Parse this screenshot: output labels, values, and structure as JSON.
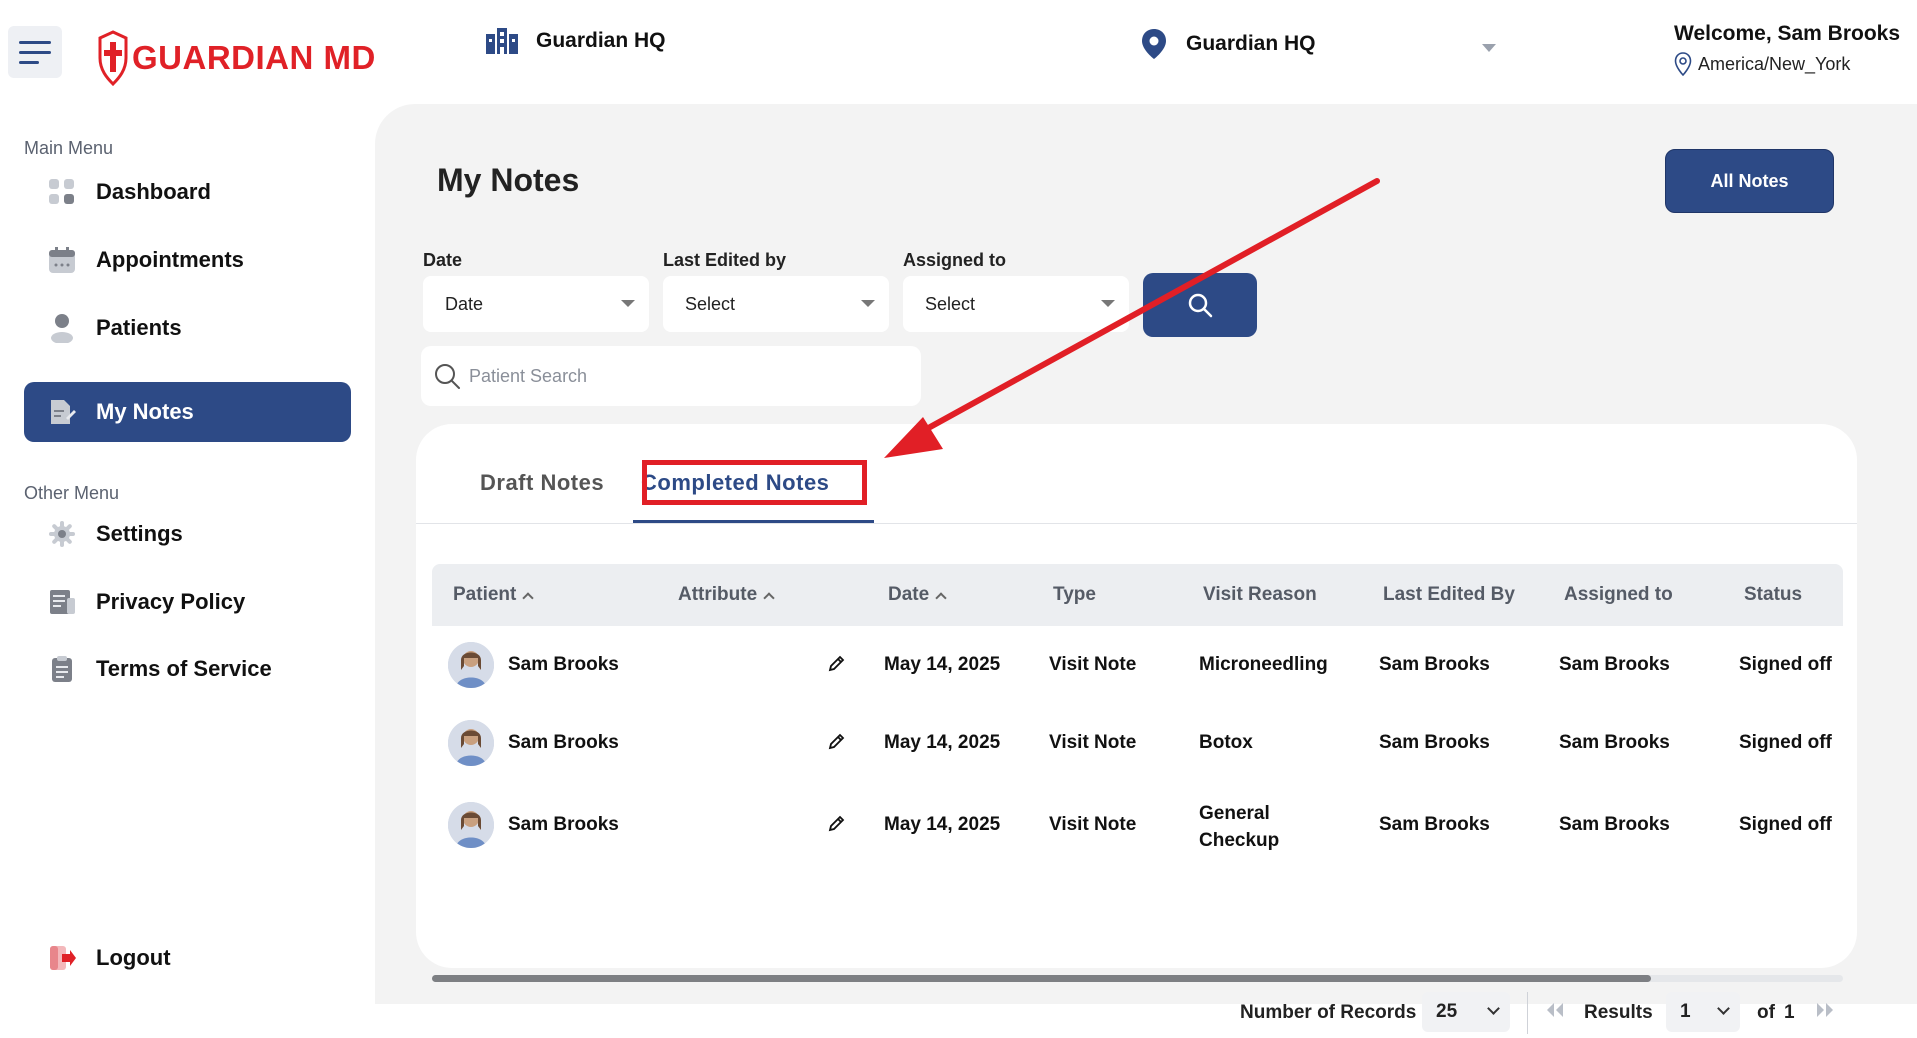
{
  "header": {
    "logo_text": "GUARDIAN MD",
    "org_name": "Guardian HQ",
    "location_name": "Guardian HQ",
    "welcome": "Welcome, Sam Brooks",
    "timezone": "America/New_York"
  },
  "sidebar": {
    "main_heading": "Main Menu",
    "other_heading": "Other Menu",
    "main_items": [
      {
        "label": "Dashboard",
        "icon": "dashboard-icon"
      },
      {
        "label": "Appointments",
        "icon": "calendar-icon"
      },
      {
        "label": "Patients",
        "icon": "user-icon"
      },
      {
        "label": "My Notes",
        "icon": "notes-icon",
        "active": true
      }
    ],
    "other_items": [
      {
        "label": "Settings",
        "icon": "gear-icon"
      },
      {
        "label": "Privacy Policy",
        "icon": "document-icon"
      },
      {
        "label": "Terms of Service",
        "icon": "clipboard-icon"
      }
    ],
    "logout": "Logout"
  },
  "main": {
    "title": "My Notes",
    "all_notes_label": "All Notes",
    "filters": {
      "date_label": "Date",
      "date_value": "Date",
      "edited_label": "Last Edited by",
      "edited_value": "Select",
      "assigned_label": "Assigned to",
      "assigned_value": "Select"
    },
    "search_placeholder": "Patient Search",
    "tabs": {
      "draft": "Draft Notes",
      "completed": "Completed Notes",
      "active": "completed"
    },
    "table": {
      "headers": [
        "Patient",
        "Attribute",
        "Date",
        "Type",
        "Visit Reason",
        "Last Edited By",
        "Assigned to",
        "Status"
      ],
      "rows": [
        [
          "Sam Brooks",
          "",
          "May 14, 2025",
          "Visit Note",
          "Microneedling",
          "Sam Brooks",
          "Sam Brooks",
          "Signed off"
        ],
        [
          "Sam Brooks",
          "",
          "May 14, 2025",
          "Visit Note",
          "Botox",
          "Sam Brooks",
          "Sam Brooks",
          "Signed off"
        ],
        [
          "Sam Brooks",
          "",
          "May 14, 2025",
          "Visit Note",
          "General Checkup",
          "Sam Brooks",
          "Sam Brooks",
          "Signed off"
        ]
      ]
    },
    "pagination": {
      "records_label": "Number of Records",
      "records_value": "25",
      "results_label": "Results",
      "page_value": "1",
      "of_label": "of",
      "total_pages": "1"
    }
  },
  "colors": {
    "brand_red": "#e02127",
    "primary_navy": "#2d4a86",
    "annotation_red": "#e11f26"
  }
}
